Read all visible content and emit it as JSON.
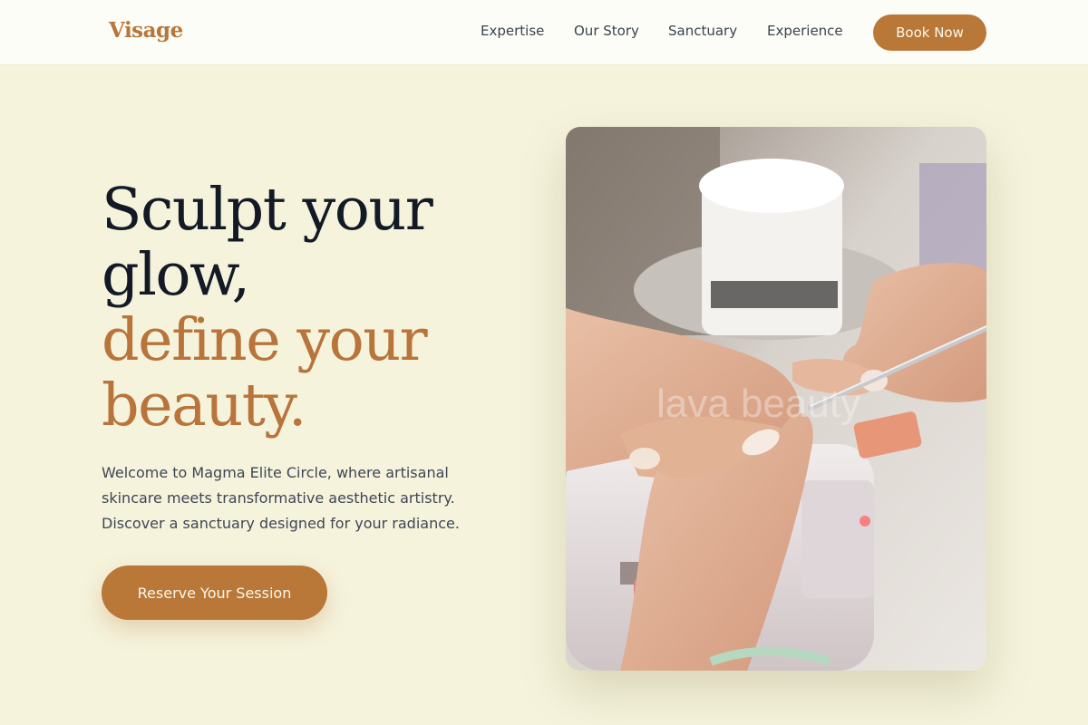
{
  "nav": {
    "brand": "Visage",
    "links": [
      "Expertise",
      "Our Story",
      "Sanctuary",
      "Experience"
    ],
    "cta": "Book Now"
  },
  "hero": {
    "title_line1": "Sculpt your",
    "title_line2": "glow,",
    "accent_line1": "define your",
    "accent_line2": "beauty.",
    "description": "Welcome to Magma Elite Circle, where artisanal skincare meets transformative aesthetic artistry. Discover a sanctuary designed for your radiance.",
    "cta": "Reserve Your Session",
    "image_watermark": "lava beauty"
  },
  "colors": {
    "background": "#f5f3dc",
    "accent": "#b97738",
    "heading": "#131a26",
    "body_text": "#3e4654"
  }
}
